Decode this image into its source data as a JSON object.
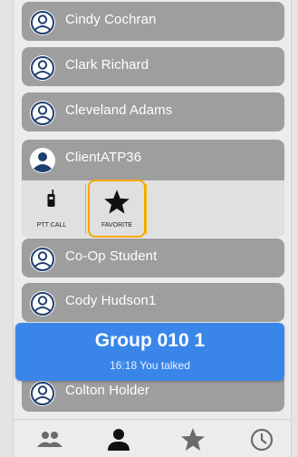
{
  "contacts": [
    {
      "name": "Cindy Cochran"
    },
    {
      "name": "Clark Richard"
    },
    {
      "name": "Cleveland Adams"
    },
    {
      "name": "ClientATP36"
    },
    {
      "name": "Co-Op Student"
    },
    {
      "name": "Cody Hudson1"
    },
    {
      "name": "Colton Holder"
    }
  ],
  "actions": {
    "ptt_label": "PTT CALL",
    "favorite_label": "FAVORITE"
  },
  "banner": {
    "title": "Group 010 1",
    "subtitle": "16:18 You talked"
  },
  "tabs": [
    "groups-tab",
    "contacts-tab",
    "favorites-tab",
    "history-tab"
  ],
  "colors": {
    "row": "#9e9e9e",
    "banner": "#3a86e8",
    "highlight": "#f5a800",
    "avatar_dark": "#1f3f6e"
  }
}
